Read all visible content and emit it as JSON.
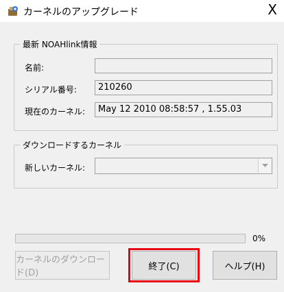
{
  "window": {
    "title": "カーネルのアップグレード",
    "close_glyph": "X",
    "icon": "app-installer-icon"
  },
  "current_info": {
    "legend": "最新 NOAHlink情報",
    "name_label": "名前:",
    "name_value": "",
    "serial_label": "シリアル番号:",
    "serial_value": "210260",
    "kernel_label": "現在のカーネル:",
    "kernel_value": "May 12 2010 08:58:57 , 1.55.03"
  },
  "download": {
    "legend": "ダウンロードするカーネル",
    "new_kernel_label": "新しいカーネル:",
    "new_kernel_value": ""
  },
  "progress": {
    "value": 0,
    "text": "0%"
  },
  "buttons": {
    "download_label": "カーネルのダウンロード(D)",
    "finish_label": "終了(C)",
    "help_label": "ヘルプ(H)"
  },
  "colors": {
    "highlight": "#e60012",
    "progress_fill": "#06b025"
  }
}
